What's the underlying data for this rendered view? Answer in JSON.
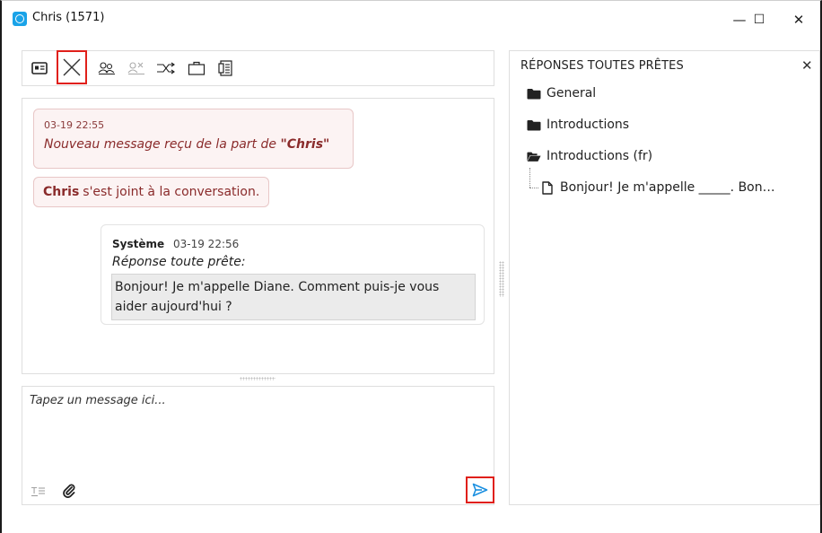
{
  "window": {
    "title": "Chris (1571)",
    "controls": {
      "minimize": "—",
      "maximize": "☐",
      "close": "✕"
    }
  },
  "toolbar": {
    "items": [
      {
        "name": "contact-card-icon"
      },
      {
        "name": "end-chat-icon",
        "highlighted": true
      },
      {
        "name": "transfer-icon"
      },
      {
        "name": "conference-icon",
        "disabled": true
      },
      {
        "name": "route-icon"
      },
      {
        "name": "briefcase-icon"
      },
      {
        "name": "notes-icon"
      }
    ]
  },
  "chat": {
    "system_message": {
      "time": "03-19 22:55",
      "text_prefix": "Nouveau message reçu de la part de ",
      "text_name": "\"Chris\""
    },
    "joined": {
      "name": "Chris",
      "text": "s'est joint à la conversation."
    },
    "agent_message": {
      "sender": "Système",
      "time": "03-19 22:56",
      "label": "Réponse toute prête:",
      "quote": "Bonjour! Je m'appelle Diane. Comment puis-je vous aider aujourd'hui ?"
    }
  },
  "composer": {
    "placeholder": "Tapez un message ici..."
  },
  "ready_responses": {
    "title": "RÉPONSES TOUTES PRÊTES",
    "close": "✕",
    "items": [
      {
        "label": "General",
        "icon": "folder-icon"
      },
      {
        "label": "Introductions",
        "icon": "folder-icon"
      },
      {
        "label": "Introductions (fr)",
        "icon": "folder-open-icon"
      },
      {
        "label": "Bonjour! Je m'appelle _____. Bon…",
        "icon": "document-icon"
      }
    ]
  },
  "colors": {
    "highlight": "#e0201a",
    "system_text": "#8a2b2b",
    "send_icon": "#1a8fe0",
    "app_icon": "#1aa3e8"
  }
}
